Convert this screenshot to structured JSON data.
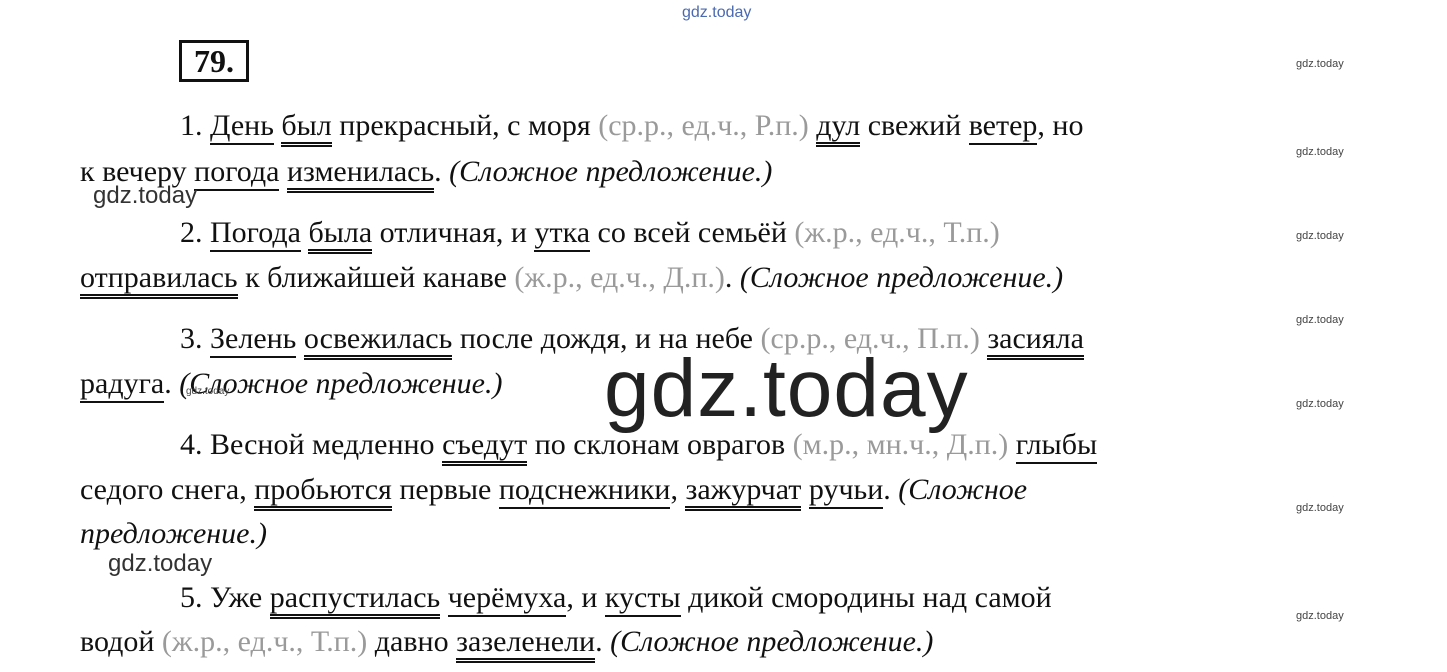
{
  "exercise_number": "79.",
  "watermarks": {
    "top": "gdz.today",
    "side": "gdz.today",
    "medium": "gdz.today",
    "big": "gdz.today"
  },
  "lines": [
    [
      {
        "t": "1. ",
        "s": ""
      },
      {
        "t": "День",
        "s": "s1"
      },
      {
        "t": " ",
        "s": ""
      },
      {
        "t": "был",
        "s": "s2"
      },
      {
        "t": " прекрасный, с моря ",
        "s": ""
      },
      {
        "t": "(ср.р., ед.ч., Р.п.)",
        "s": "g"
      },
      {
        "t": " ",
        "s": ""
      },
      {
        "t": "дул",
        "s": "s2"
      },
      {
        "t": " свежий ",
        "s": ""
      },
      {
        "t": "ветер",
        "s": "s1"
      },
      {
        "t": ", но",
        "s": ""
      }
    ],
    [
      {
        "t": "к вечеру ",
        "s": ""
      },
      {
        "t": "погода",
        "s": "s1"
      },
      {
        "t": " ",
        "s": ""
      },
      {
        "t": "изменилась",
        "s": "s2"
      },
      {
        "t": ". ",
        "s": ""
      },
      {
        "t": "(Сложное предложение.)",
        "s": "i"
      }
    ],
    [
      {
        "t": "2. ",
        "s": ""
      },
      {
        "t": "Погода",
        "s": "s1"
      },
      {
        "t": " ",
        "s": ""
      },
      {
        "t": "была",
        "s": "s2"
      },
      {
        "t": " отличная, и ",
        "s": ""
      },
      {
        "t": "утка",
        "s": "s1"
      },
      {
        "t": " со всей семьёй ",
        "s": ""
      },
      {
        "t": "(ж.р., ед.ч., Т.п.)",
        "s": "g"
      }
    ],
    [
      {
        "t": "отправилась",
        "s": "s2"
      },
      {
        "t": " к ближайшей канаве ",
        "s": ""
      },
      {
        "t": "(ж.р., ед.ч., Д.п.)",
        "s": "g"
      },
      {
        "t": ". ",
        "s": ""
      },
      {
        "t": "(Сложное предложение.)",
        "s": "i"
      }
    ],
    [
      {
        "t": "3. ",
        "s": ""
      },
      {
        "t": "Зелень",
        "s": "s1"
      },
      {
        "t": " ",
        "s": ""
      },
      {
        "t": "освежилась",
        "s": "s2"
      },
      {
        "t": " после дождя, и на небе ",
        "s": ""
      },
      {
        "t": "(ср.р., ед.ч., П.п.)",
        "s": "g"
      },
      {
        "t": " ",
        "s": ""
      },
      {
        "t": "засияла",
        "s": "s2"
      }
    ],
    [
      {
        "t": "радуга",
        "s": "s1"
      },
      {
        "t": ". ",
        "s": ""
      },
      {
        "t": "(Сложное предложение.)",
        "s": "i"
      }
    ],
    [
      {
        "t": "4. Весной медленно ",
        "s": ""
      },
      {
        "t": "съедут",
        "s": "s2"
      },
      {
        "t": " по склонам оврагов ",
        "s": ""
      },
      {
        "t": "(м.р., мн.ч., Д.п.)",
        "s": "g"
      },
      {
        "t": " ",
        "s": ""
      },
      {
        "t": "глыбы",
        "s": "s1"
      }
    ],
    [
      {
        "t": "седого снега, ",
        "s": ""
      },
      {
        "t": "пробьются",
        "s": "s2"
      },
      {
        "t": " первые ",
        "s": ""
      },
      {
        "t": "подснежники",
        "s": "s1"
      },
      {
        "t": ", ",
        "s": ""
      },
      {
        "t": "зажурчат",
        "s": "s2"
      },
      {
        "t": " ",
        "s": ""
      },
      {
        "t": "ручьи",
        "s": "s1"
      },
      {
        "t": ". ",
        "s": ""
      },
      {
        "t": "(Сложное",
        "s": "i"
      }
    ],
    [
      {
        "t": "предложение.)",
        "s": "i"
      }
    ],
    [
      {
        "t": "5. Уже ",
        "s": ""
      },
      {
        "t": "распустилась",
        "s": "s2"
      },
      {
        "t": " ",
        "s": ""
      },
      {
        "t": "черёмуха",
        "s": "s1"
      },
      {
        "t": ", и ",
        "s": ""
      },
      {
        "t": "кусты",
        "s": "s1"
      },
      {
        "t": " дикой смородины над самой",
        "s": ""
      }
    ],
    [
      {
        "t": "водой ",
        "s": ""
      },
      {
        "t": "(ж.р., ед.ч., Т.п.)",
        "s": "g"
      },
      {
        "t": " давно ",
        "s": ""
      },
      {
        "t": "зазеленели",
        "s": "s2"
      },
      {
        "t": ". ",
        "s": ""
      },
      {
        "t": "(Сложное предложение.)",
        "s": "i"
      }
    ]
  ]
}
